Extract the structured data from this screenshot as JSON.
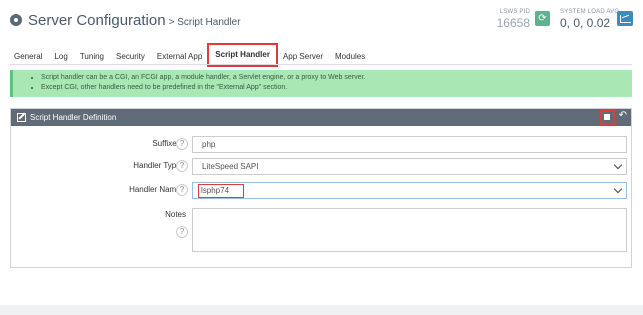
{
  "header": {
    "title": "Server Configuration",
    "crumb": "> Script Handler",
    "pid_label": "LSWS PID",
    "pid_value": "16658",
    "load_label": "SYSTEM LOAD AVG",
    "load_value": "0, 0, 0.02"
  },
  "tabs": [
    "General",
    "Log",
    "Tuning",
    "Security",
    "External App",
    "Script Handler",
    "App Server",
    "Modules"
  ],
  "active_tab": "Script Handler",
  "info": {
    "lines": [
      "Script handler can be a CGI, an FCGI app, a module handler, a Servlet engine, or a proxy to Web server.",
      "Except CGI, other handlers need to be predefined in the \"External App\" section."
    ]
  },
  "panel": {
    "title": "Script Handler Definition",
    "fields": {
      "suffixes_label": "Suffixes *",
      "suffixes_value": "php",
      "handler_type_label": "Handler Type *",
      "handler_type_value": "LiteSpeed SAPI",
      "handler_name_label": "Handler Name *",
      "handler_name_value": "lsphp74",
      "notes_label": "Notes",
      "notes_value": ""
    }
  },
  "colors": {
    "accent_red": "#e03a3a",
    "panel_header": "#5f6b76",
    "info_bg": "#a9e8b5",
    "restart_green": "#5bb38f",
    "chart_blue": "#3c8dbc"
  }
}
